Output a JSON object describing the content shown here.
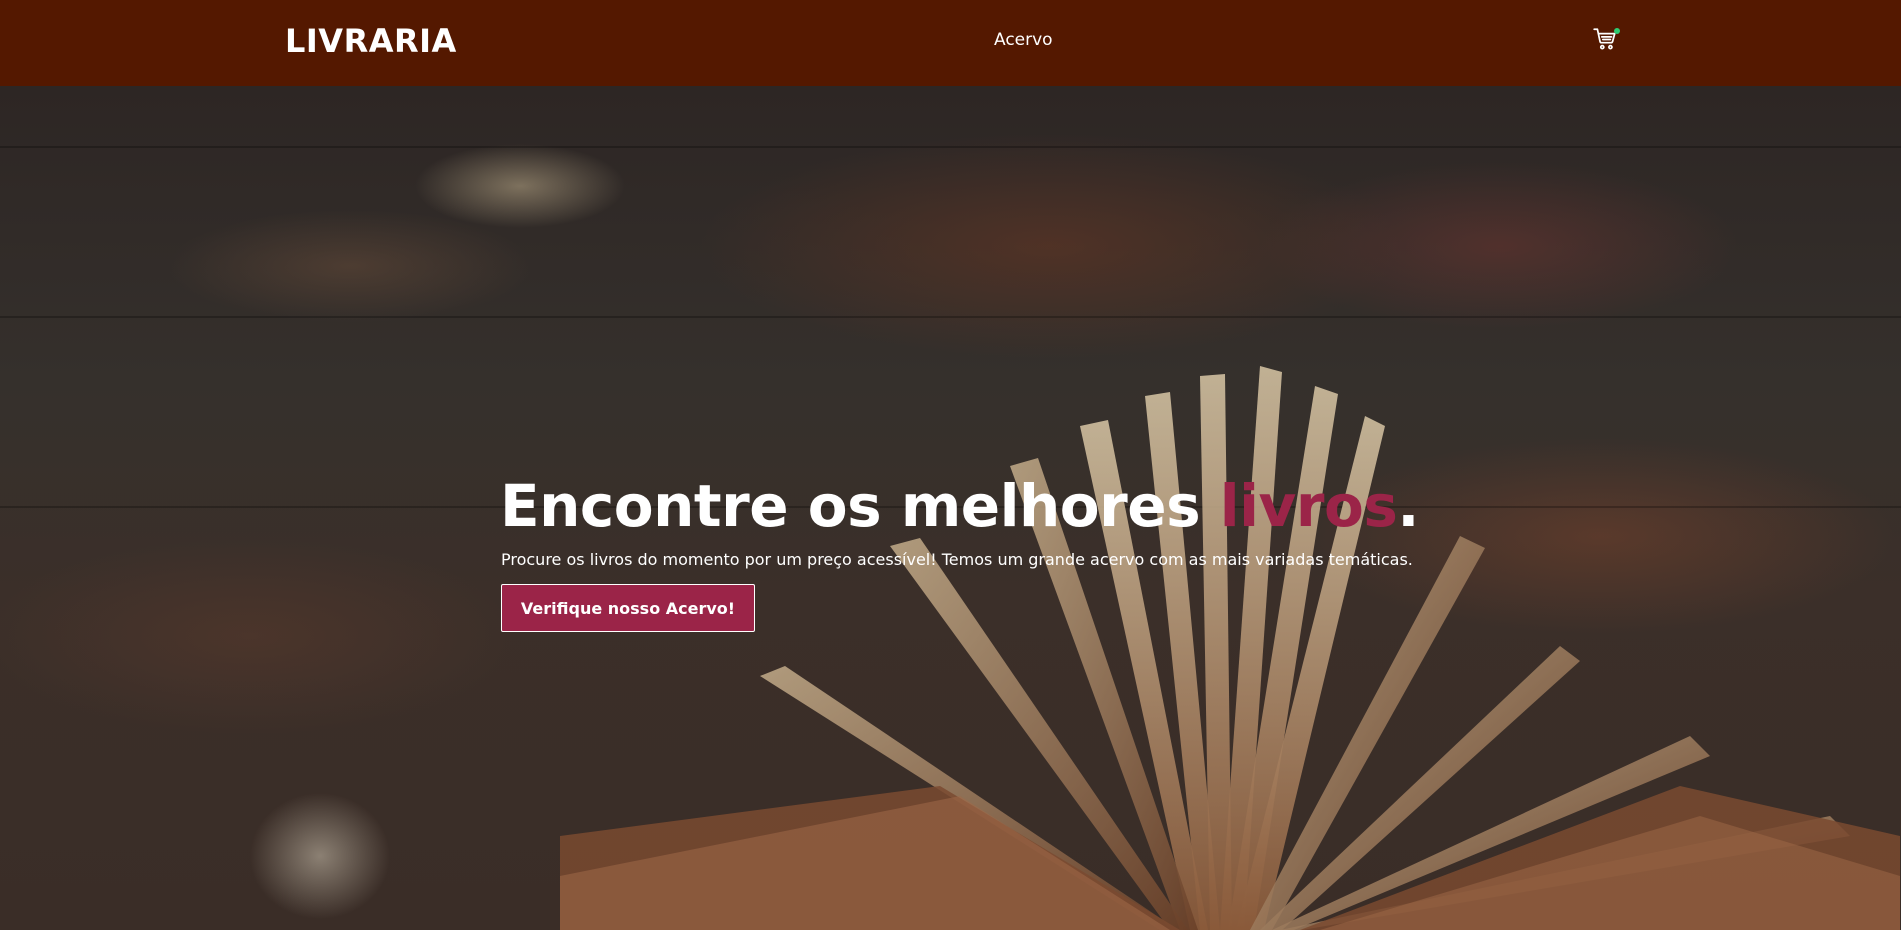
{
  "header": {
    "logo": "LIVRARIA",
    "nav": [
      {
        "label": "Acervo"
      }
    ],
    "cart_icon": "shopping-cart-icon",
    "cart_badge_color": "#2ecc71",
    "background_color": "#541800"
  },
  "hero": {
    "headline_main": "Encontre os melhores ",
    "headline_accent": "livros",
    "headline_end": ".",
    "subtitle": "Procure os livros do momento por um preço acessível! Temos um grande acervo com as mais variadas temáticas.",
    "cta_label": "Verifique nosso Acervo!",
    "accent_color": "#9b2448"
  }
}
